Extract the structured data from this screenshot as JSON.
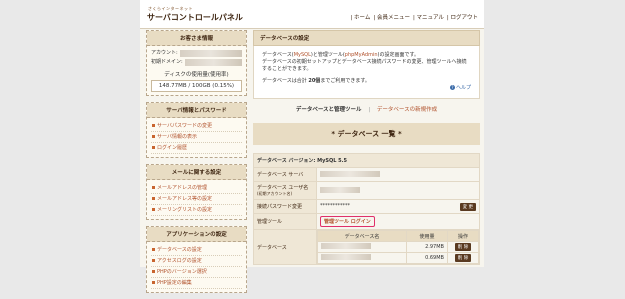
{
  "header": {
    "small_text": "さくらインターネット",
    "title": "サーバコントロールパネル",
    "nav": [
      "| ホーム",
      "| 会員メニュー",
      "| マニュアル",
      "| ログアウト"
    ]
  },
  "sidebar": {
    "customer_info": {
      "title": "お客さま情報",
      "account_label": "アカウント:",
      "domain_label": "初期ドメイン:",
      "disk_label": "ディスクの使用量(使用率)",
      "disk_value": "148.77MB / 100GB (0.15%)"
    },
    "server_info": {
      "title": "サーバ情報とパスワード",
      "items": [
        "サーバパスワードの変更",
        "サーバ情報の表示",
        "ログイン履歴"
      ]
    },
    "mail": {
      "title": "メールに関する設定",
      "items": [
        "メールアドレスの管理",
        "メールアドレス等の設定",
        "メーリングリストの設定"
      ]
    },
    "app": {
      "title": "アプリケーションの設定",
      "items": [
        "データベースの設定",
        "アクセスログの設定",
        "PHPのバージョン選択",
        "PHP設定の編集"
      ]
    }
  },
  "main": {
    "title": "データベースの設定",
    "info_line1_a": "データベース(",
    "info_line1_b": "MySQL",
    "info_line1_c": ")と管理ツール(",
    "info_line1_d": "phpMyAdmin",
    "info_line1_e": ")の設定画面です。",
    "info_line2": "データベースの初期セットアップとデータベース接続パスワードの変更、管理ツールへ接続",
    "info_line3": "することができます。",
    "info_line4_a": "データベースは合計 ",
    "info_line4_b": "20個",
    "info_line4_c": "までご利用できます。",
    "help": "ヘルプ",
    "subnav_current": "データベースと管理ツール",
    "subnav_sep": "|",
    "subnav_link": "データベースの新規作成",
    "db_title": "* データベース 一覧 *",
    "version_text": "データベース バージョン: MySQL 5.5",
    "rows": {
      "server": "データベース サーバ",
      "user": "データベース ユーザ名",
      "user_sub": "(初期アカウント名)",
      "password": "接続パスワード変更",
      "password_mask": "************",
      "password_button": "変 更",
      "tool": "管理ツール",
      "tool_link": "管理ツール ログイン",
      "db": "データベース"
    },
    "db_table": {
      "headers": [
        "データベース名",
        "使用量",
        "操作"
      ],
      "rows": [
        {
          "usage": "2.97MB",
          "action": "削 除"
        },
        {
          "usage": "0.69MB",
          "action": "削 除"
        }
      ]
    }
  }
}
